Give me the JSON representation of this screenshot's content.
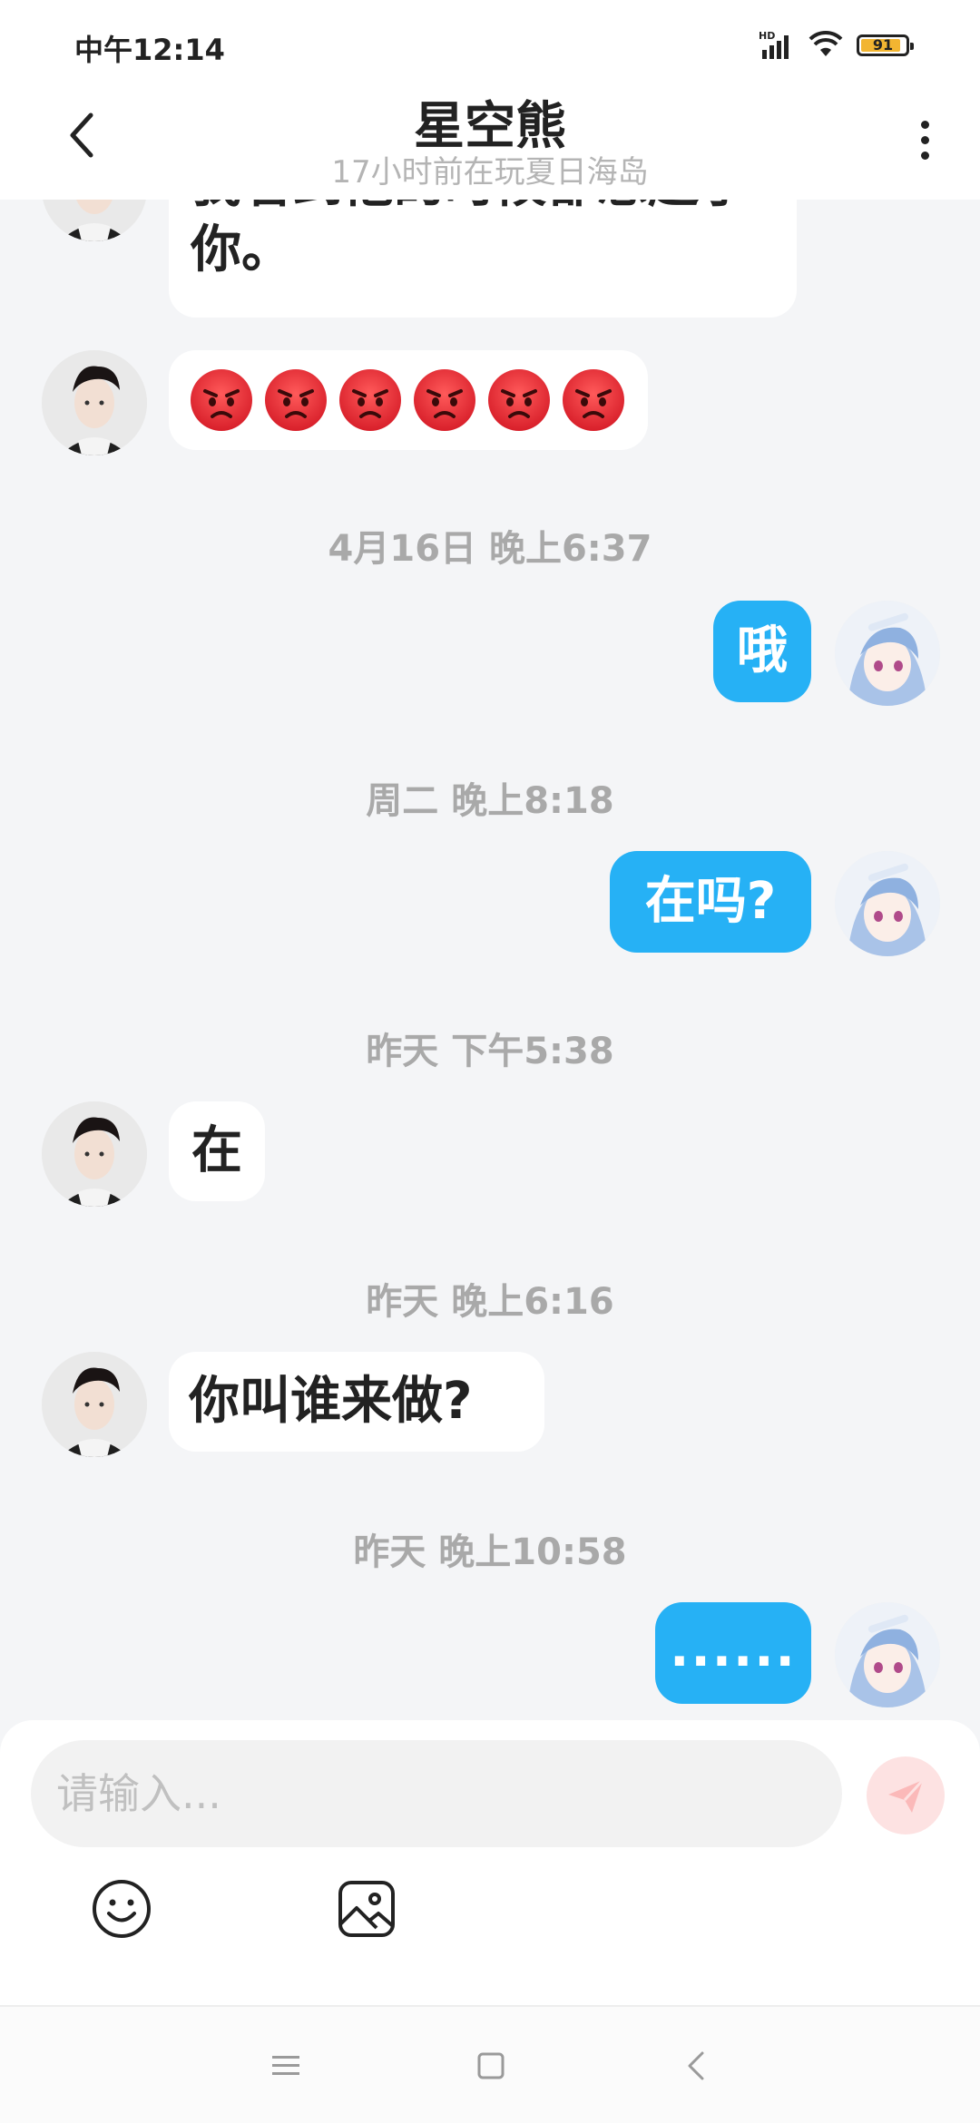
{
  "status_bar": {
    "time": "中午12:14",
    "network_label": "HD",
    "battery_level": "91",
    "battery_percent": 91,
    "battery_color": "#f2b531"
  },
  "header": {
    "title": "星空熊",
    "subtitle": "17小时前在玩夏日海岛",
    "back_icon": "chevron-left-icon",
    "more_icon": "more-vertical-icon"
  },
  "messages": [
    {
      "type": "in",
      "text_line1": "我看到他的时候都想起了",
      "text_line2": "你。"
    },
    {
      "type": "in",
      "emoji": "angry-face",
      "emoji_count": 6
    },
    {
      "type": "timestamp",
      "text": "4月16日 晚上6:37"
    },
    {
      "type": "out",
      "text": "哦"
    },
    {
      "type": "timestamp",
      "text": "周二 晚上8:18"
    },
    {
      "type": "out",
      "text": "在吗?"
    },
    {
      "type": "timestamp",
      "text": "昨天 下午5:38"
    },
    {
      "type": "in",
      "text": "在"
    },
    {
      "type": "timestamp",
      "text": "昨天 晚上6:16"
    },
    {
      "type": "in",
      "text": "你叫谁来做?"
    },
    {
      "type": "timestamp",
      "text": "昨天 晚上10:58"
    },
    {
      "type": "out",
      "text": "......"
    }
  ],
  "composer": {
    "placeholder": "请输入...",
    "send_icon": "send-icon",
    "emoji_icon": "smiley-icon",
    "image_icon": "image-icon"
  },
  "colors": {
    "outgoing_bubble": "#26b1f5",
    "incoming_bubble": "#ffffff",
    "background": "#f4f5f7",
    "timestamp": "#a9a9a9"
  },
  "nav_bar": {
    "menu_icon": "menu-icon",
    "home_icon": "home-icon",
    "back_icon": "back-icon"
  }
}
